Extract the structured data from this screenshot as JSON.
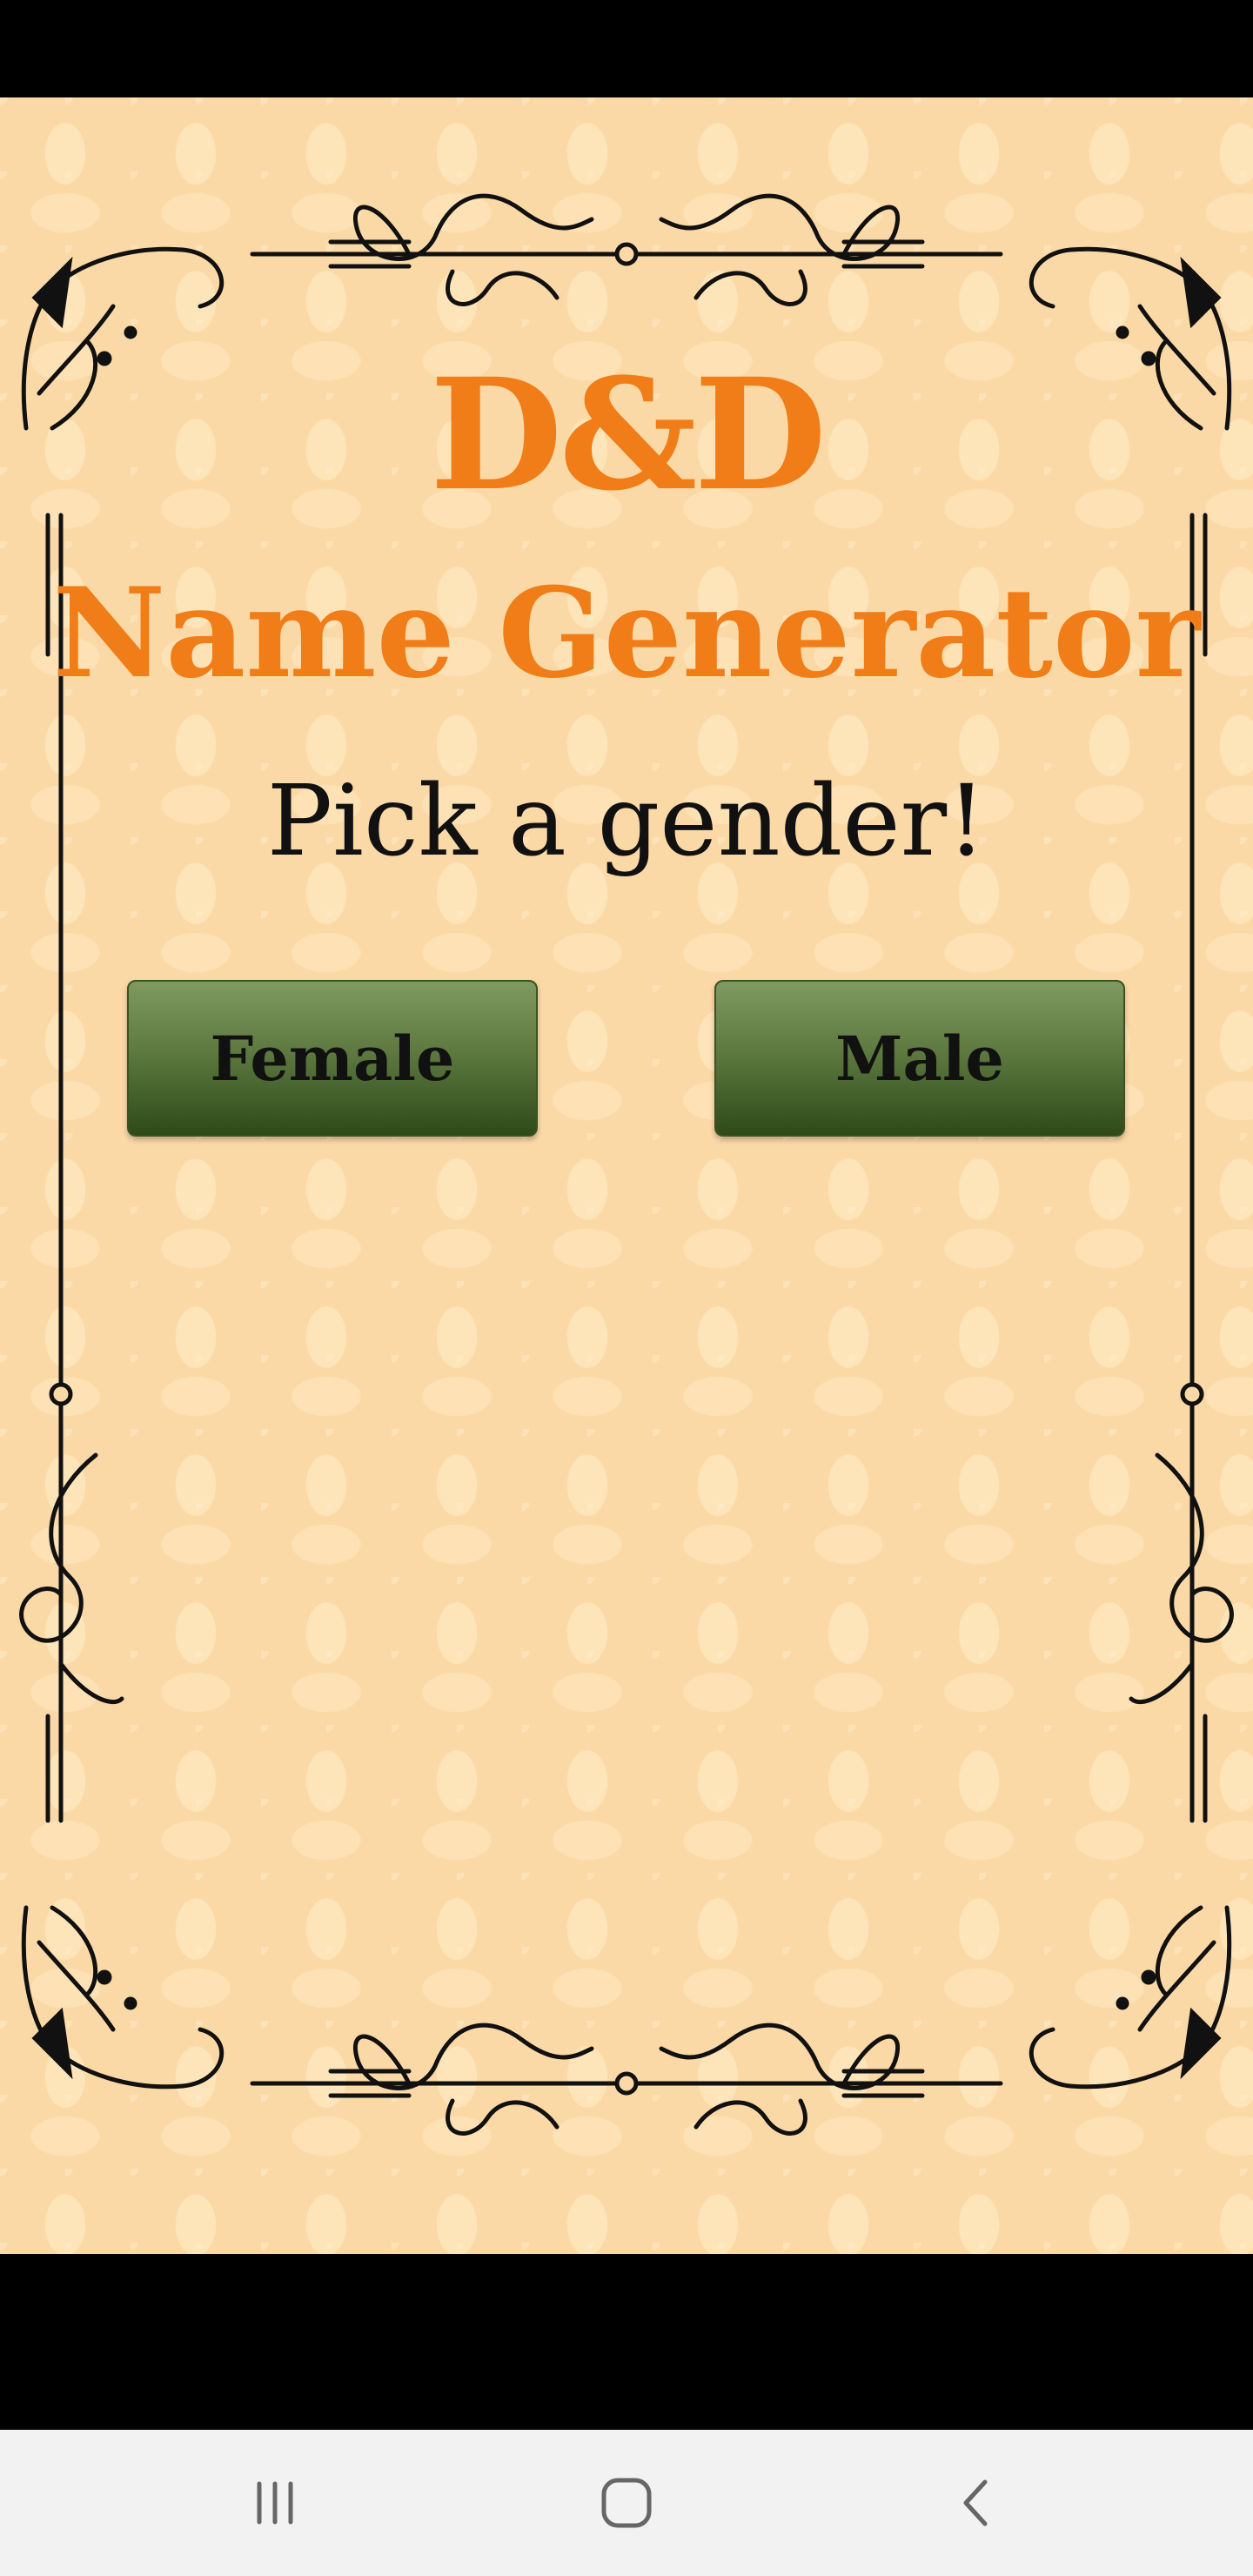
{
  "app": {
    "title_line1": "D&D",
    "title_line2": "Name Generator",
    "prompt": "Pick a gender!"
  },
  "buttons": {
    "female_label": "Female",
    "male_label": "Male"
  },
  "nav_bar": {
    "recents_icon": "recents-icon",
    "home_icon": "home-icon",
    "back_icon": "back-icon"
  },
  "colors": {
    "title": "#f07d17",
    "parchment": "#fbd9a6",
    "button_top": "#7f9a60",
    "button_bottom": "#2f4a18",
    "ornament": "#111111"
  }
}
